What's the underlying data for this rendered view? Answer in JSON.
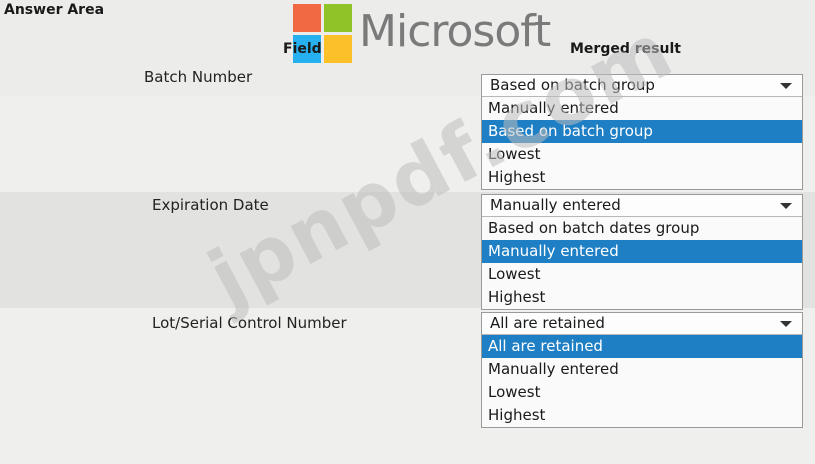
{
  "title": "Answer Area",
  "watermarks": {
    "logo_text": "Microsoft",
    "site": "jpnpdf.com"
  },
  "headers": {
    "field": "Field",
    "result": "Merged result"
  },
  "rows": [
    {
      "label": "Batch Number",
      "selected": "Based on batch group",
      "options": [
        "Manually entered",
        "Based on batch group",
        "Lowest",
        "Highest"
      ],
      "highlighted": "Based on batch group"
    },
    {
      "label": "Expiration Date",
      "selected": "Manually entered",
      "options": [
        "Based on batch dates group",
        "Manually entered",
        "Lowest",
        "Highest"
      ],
      "highlighted": "Manually entered"
    },
    {
      "label": "Lot/Serial Control Number",
      "selected": "All are retained",
      "options": [
        "All are retained",
        "Manually entered",
        "Lowest",
        "Highest"
      ],
      "highlighted": "All are retained"
    }
  ],
  "colors": {
    "highlight": "#1e7fc4",
    "background": "#e6e6e4"
  }
}
